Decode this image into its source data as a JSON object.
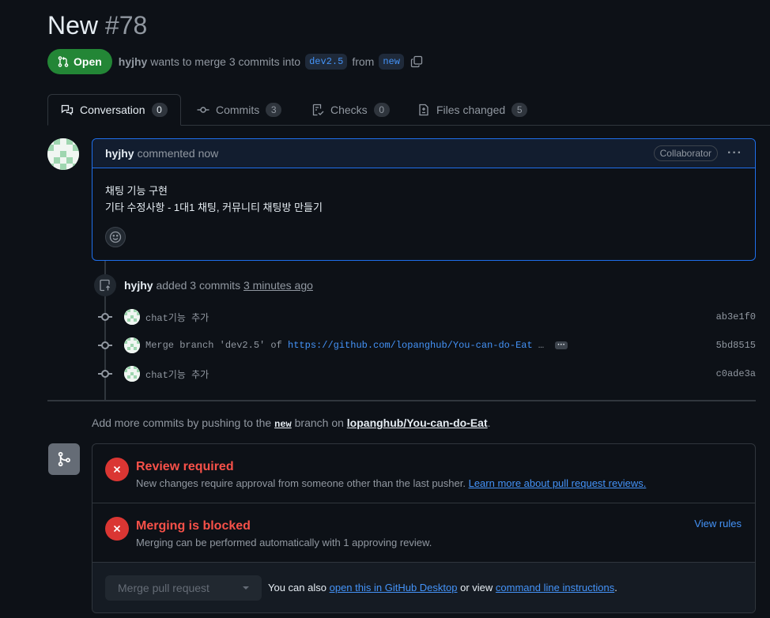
{
  "header": {
    "title": "New",
    "number": "#78",
    "state": "Open",
    "author": "hyjhy",
    "merge_text": "wants to merge 3 commits into",
    "base_branch": "dev2.5",
    "from_text": "from",
    "head_branch": "new"
  },
  "tabs": [
    {
      "label": "Conversation",
      "count": "0"
    },
    {
      "label": "Commits",
      "count": "3"
    },
    {
      "label": "Checks",
      "count": "0"
    },
    {
      "label": "Files changed",
      "count": "5"
    }
  ],
  "comment": {
    "author": "hyjhy",
    "meta": "commented now",
    "role": "Collaborator",
    "kebab": "···",
    "body_line1": "채팅 기능 구현",
    "body_line2": "기타 수정사항 - 1대1 채팅, 커뮤니티 채팅방 만들기"
  },
  "commit_event": {
    "author": "hyjhy",
    "action": "added 3 commits",
    "time": "3 minutes ago"
  },
  "commits": [
    {
      "message": "chat기능 추가",
      "link": "",
      "suffix": "",
      "sha": "ab3e1f0"
    },
    {
      "message": "Merge branch 'dev2.5' of ",
      "link": "https://github.com/lopanghub/You-can-do-Eat",
      "suffix": " …",
      "more": "···",
      "sha": "5bd8515"
    },
    {
      "message": "chat기능 추가",
      "link": "",
      "suffix": "",
      "sha": "c0ade3a"
    }
  ],
  "push_hint": {
    "prefix": "Add more commits by pushing to the",
    "branch": "new",
    "middle": "branch on",
    "repo": "lopanghub/You-can-do-Eat",
    "end": "."
  },
  "merge": {
    "review_title": "Review required",
    "review_desc": "New changes require approval from someone other than the last pusher.",
    "review_link": "Learn more about pull request reviews.",
    "blocked_title": "Merging is blocked",
    "blocked_desc": "Merging can be performed automatically with 1 approving review.",
    "view_rules": "View rules",
    "merge_button": "Merge pull request",
    "footer_prefix": "You can also",
    "footer_link1": "open this in GitHub Desktop",
    "footer_middle": "or view",
    "footer_link2": "command line instructions",
    "footer_end": "."
  },
  "colors": {
    "background": "#0d1117",
    "open_badge": "#238636",
    "link": "#4493f8",
    "error": "#f85149",
    "comment_border": "#1f6feb"
  }
}
